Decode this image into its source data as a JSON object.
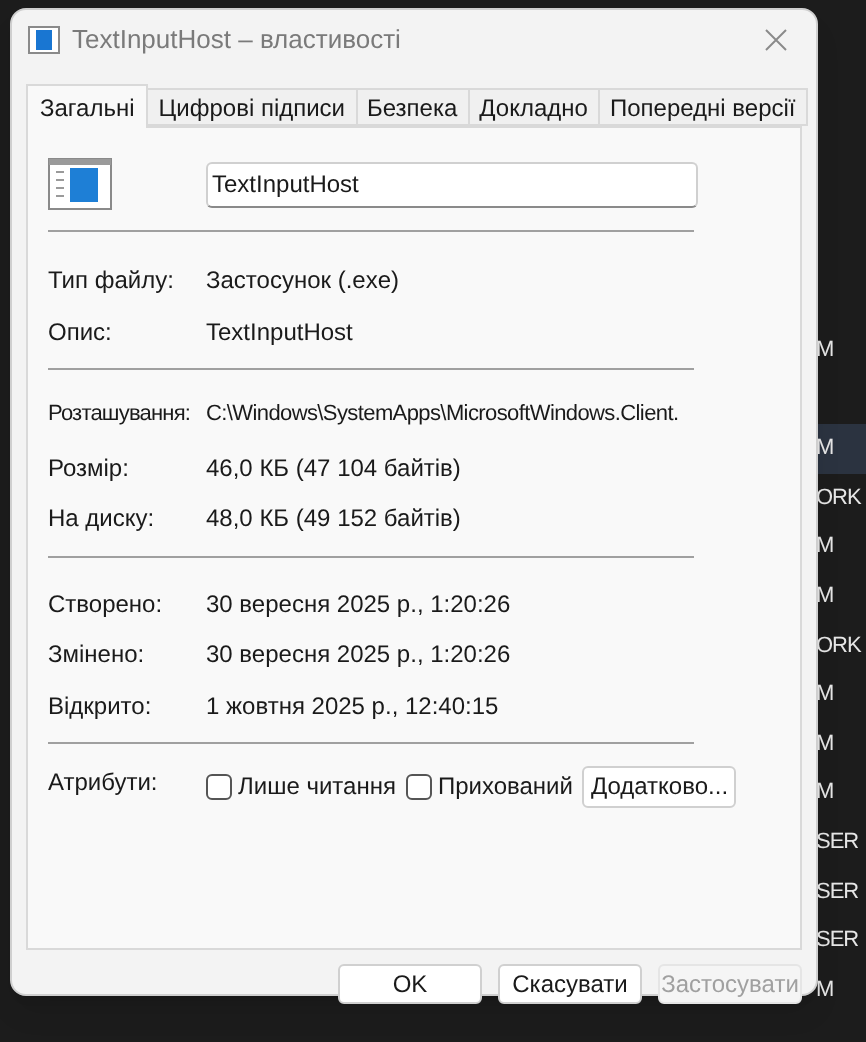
{
  "background": {
    "rows": [
      {
        "text": "M",
        "selected": false
      },
      {
        "selected": false
      },
      {
        "text": "M",
        "selected": true
      },
      {
        "text": "ORK",
        "selected": false
      },
      {
        "text": "M",
        "selected": false
      },
      {
        "text": "M",
        "selected": false
      },
      {
        "text": "ORK",
        "selected": false
      },
      {
        "text": "M",
        "selected": false
      },
      {
        "text": "M",
        "selected": false
      },
      {
        "text": "M",
        "selected": false
      },
      {
        "text": "SER",
        "selected": false
      },
      {
        "text": "SER",
        "selected": false
      },
      {
        "text": "SER",
        "selected": false
      },
      {
        "text": "M",
        "selected": false
      }
    ]
  },
  "window": {
    "title": "TextInputHost – властивості"
  },
  "tabs": [
    {
      "label": "Загальні",
      "selected": true
    },
    {
      "label": "Цифрові підписи",
      "selected": false
    },
    {
      "label": "Безпека",
      "selected": false
    },
    {
      "label": "Докладно",
      "selected": false
    },
    {
      "label": "Попередні версії",
      "selected": false
    }
  ],
  "general": {
    "name": "TextInputHost",
    "sections": [
      [
        {
          "label": "Тип файлу:",
          "value": "Застосунок (.exe)"
        },
        {
          "label": "Опис:",
          "value": "TextInputHost"
        }
      ],
      [
        {
          "label": "Розташування:",
          "value": "C:\\Windows\\SystemApps\\MicrosoftWindows.Client."
        },
        {
          "label": "Розмір:",
          "value": "46,0 КБ (47 104 байтів)"
        },
        {
          "label": "На диску:",
          "value": "48,0 КБ (49 152 байтів)"
        }
      ],
      [
        {
          "label": "Створено:",
          "value": "30 вересня 2025 р., 1:20:26"
        },
        {
          "label": "Змінено:",
          "value": "30 вересня 2025 р., 1:20:26"
        },
        {
          "label": "Відкрито:",
          "value": "1 жовтня 2025 р., 12:40:15"
        }
      ]
    ],
    "attributes": {
      "label": "Атрибути:",
      "checkboxes": [
        {
          "label": "Лише читання",
          "checked": false
        },
        {
          "label": "Прихований",
          "checked": false
        }
      ],
      "button": "Додатково..."
    }
  },
  "buttons": [
    {
      "label": "OK",
      "disabled": false
    },
    {
      "label": "Скасувати",
      "disabled": false
    },
    {
      "label": "Застосувати",
      "disabled": true
    }
  ]
}
